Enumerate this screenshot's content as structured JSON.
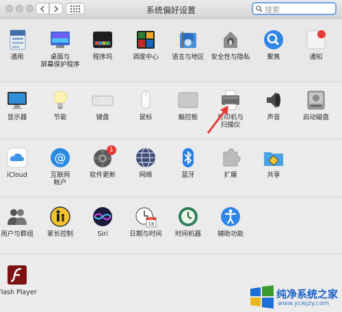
{
  "window": {
    "title": "系统偏好设置"
  },
  "search": {
    "placeholder": "搜索"
  },
  "rows": [
    [
      {
        "label": "通用",
        "icon": "general-icon"
      },
      {
        "label": "桌面与\n屏幕保护程序",
        "icon": "desktop-screensaver-icon"
      },
      {
        "label": "程序坞",
        "icon": "dock-icon"
      },
      {
        "label": "调度中心",
        "icon": "mission-control-icon"
      },
      {
        "label": "语言与地区",
        "icon": "language-region-icon"
      },
      {
        "label": "安全性与隐私",
        "icon": "security-privacy-icon"
      },
      {
        "label": "聚焦",
        "icon": "spotlight-icon"
      },
      {
        "label": "通知",
        "icon": "notifications-icon"
      }
    ],
    [
      {
        "label": "显示器",
        "icon": "displays-icon"
      },
      {
        "label": "节能",
        "icon": "energy-saver-icon"
      },
      {
        "label": "键盘",
        "icon": "keyboard-icon"
      },
      {
        "label": "鼠标",
        "icon": "mouse-icon"
      },
      {
        "label": "触控板",
        "icon": "trackpad-icon"
      },
      {
        "label": "打印机与\n扫描仪",
        "icon": "printers-scanners-icon"
      },
      {
        "label": "声音",
        "icon": "sound-icon"
      },
      {
        "label": "启动磁盘",
        "icon": "startup-disk-icon"
      }
    ],
    [
      {
        "label": "iCloud",
        "icon": "icloud-icon"
      },
      {
        "label": "互联网\n帐户",
        "icon": "internet-accounts-icon"
      },
      {
        "label": "软件更新",
        "icon": "software-update-icon",
        "badge": "1"
      },
      {
        "label": "网络",
        "icon": "network-icon"
      },
      {
        "label": "蓝牙",
        "icon": "bluetooth-icon"
      },
      {
        "label": "扩展",
        "icon": "extensions-icon"
      },
      {
        "label": "共享",
        "icon": "sharing-icon"
      }
    ],
    [
      {
        "label": "用户与群组",
        "icon": "users-groups-icon"
      },
      {
        "label": "家长控制",
        "icon": "parental-controls-icon"
      },
      {
        "label": "Siri",
        "icon": "siri-icon"
      },
      {
        "label": "日期与时间",
        "icon": "date-time-icon"
      },
      {
        "label": "时间机器",
        "icon": "time-machine-icon"
      },
      {
        "label": "辅助功能",
        "icon": "accessibility-icon"
      }
    ],
    [
      {
        "label": "Flash Player",
        "icon": "flash-player-icon"
      }
    ]
  ],
  "calendar": {
    "month": "JUL",
    "day": "18"
  },
  "watermark": {
    "brand": "纯净系统之家",
    "url": "www.ycwjzy.com"
  }
}
